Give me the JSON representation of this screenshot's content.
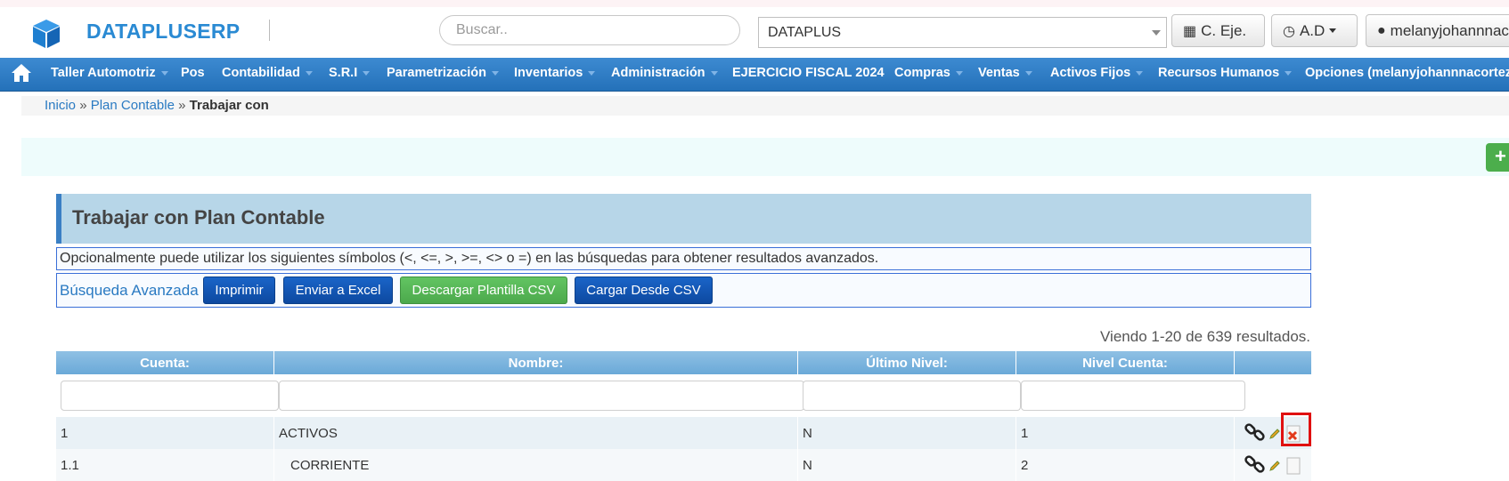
{
  "header": {
    "brand": "DATAPLUSERP",
    "search_placeholder": "Buscar..",
    "company_value": "DATAPLUS",
    "period_button": "C. Eje.",
    "role_button": "A.D",
    "user_button": "melanyjohannnacortez"
  },
  "navbar": {
    "items": [
      {
        "label": "Taller Automotriz",
        "dropdown": true
      },
      {
        "label": "Pos",
        "dropdown": false
      },
      {
        "label": "Contabilidad",
        "dropdown": true
      },
      {
        "label": "S.R.I",
        "dropdown": true
      },
      {
        "label": "Parametrización",
        "dropdown": true
      },
      {
        "label": "Inventarios",
        "dropdown": true
      },
      {
        "label": "Administración",
        "dropdown": true
      },
      {
        "label": "EJERCICIO FISCAL 2024",
        "dropdown": false
      },
      {
        "label": "Compras",
        "dropdown": true
      },
      {
        "label": "Ventas",
        "dropdown": true
      },
      {
        "label": "Activos Fijos",
        "dropdown": true
      },
      {
        "label": "Recursos Humanos",
        "dropdown": true
      },
      {
        "label": "Opciones (melanyjohannnacortez)",
        "dropdown": false
      }
    ]
  },
  "breadcrumb": {
    "home": "Inicio",
    "sep": "»",
    "section": "Plan Contable",
    "current": "Trabajar con"
  },
  "panel": {
    "title": "Trabajar con Plan Contable",
    "hint": "Opcionalmente puede utilizar los siguientes símbolos (<, <=, >, >=, <> o =) en las búsquedas para obtener resultados avanzados.",
    "advanced_search": "Búsqueda Avanzada",
    "buttons": {
      "print": "Imprimir",
      "excel": "Enviar a Excel",
      "download_csv": "Descargar Plantilla CSV",
      "load_csv": "Cargar Desde CSV"
    }
  },
  "grid": {
    "summary": "Viendo 1-20 de 639 resultados.",
    "columns": [
      "Cuenta:",
      "Nombre:",
      "Último Nivel:",
      "Nivel Cuenta:"
    ],
    "rows": [
      {
        "cuenta": "1",
        "nombre": "ACTIVOS",
        "ultimo_nivel": "N",
        "nivel_cuenta": "1"
      },
      {
        "cuenta": "1.1",
        "nombre": "CORRIENTE",
        "ultimo_nivel": "N",
        "nivel_cuenta": "2"
      }
    ]
  },
  "colors": {
    "brand": "#2a8ad3",
    "navbar": "#2f7fc6",
    "grid_header": "#7db5de",
    "primary_button": "#1558b4",
    "success_button": "#5cb85c",
    "highlight": "#e01010"
  }
}
